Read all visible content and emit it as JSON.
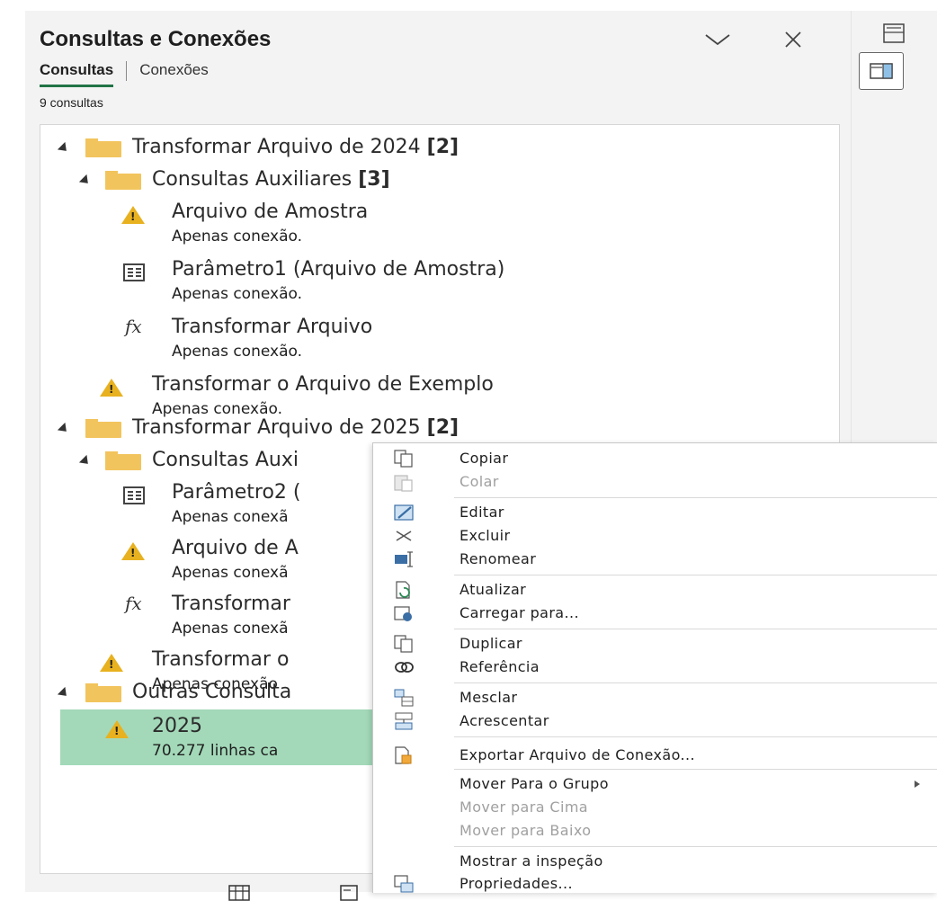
{
  "pane": {
    "title": "Consultas e Conexões",
    "tabs": [
      {
        "label": "Consultas",
        "active": true
      },
      {
        "label": "Conexões",
        "active": false
      }
    ],
    "query_count": "9 consultas"
  },
  "tree": {
    "group1": {
      "name": "Transformar Arquivo de 2024",
      "badge": "[2]"
    },
    "group1_sub": {
      "name": "Consultas Auxiliares",
      "badge": "[3]"
    },
    "q1": {
      "name": "Arquivo de Amostra",
      "status": "Apenas conexão."
    },
    "q2": {
      "name": "Parâmetro1 (Arquivo de Amostra)",
      "status": "Apenas conexão."
    },
    "q3": {
      "name": "Transformar Arquivo",
      "status": "Apenas conexão."
    },
    "q4": {
      "name": "Transformar o Arquivo de Exemplo",
      "status": "Apenas conexão."
    },
    "group2": {
      "name": "Transformar Arquivo de 2025",
      "badge": "[2]"
    },
    "group2_sub": {
      "name": "Consultas Auxi"
    },
    "q5": {
      "name": "Parâmetro2 (",
      "status": "Apenas conexã"
    },
    "q6": {
      "name": "Arquivo de A",
      "status": "Apenas conexã"
    },
    "q7": {
      "name": "Transformar ",
      "status": "Apenas conexã"
    },
    "q8": {
      "name": "Transformar o",
      "status": "Apenas conexão"
    },
    "group3": {
      "name": "Outras Consulta"
    },
    "q9": {
      "name": "2025",
      "status": "70.277 linhas ca"
    }
  },
  "context_menu": {
    "items": [
      {
        "label": "Copiar",
        "enabled": true,
        "icon": "copy-icon"
      },
      {
        "label": "Colar",
        "enabled": false,
        "icon": "paste-icon"
      },
      {
        "label": "Editar",
        "enabled": true,
        "icon": "edit-icon"
      },
      {
        "label": "Excluir",
        "enabled": true,
        "icon": "delete-icon"
      },
      {
        "label": "Renomear",
        "enabled": true,
        "icon": "rename-icon"
      },
      {
        "label": "Atualizar",
        "enabled": true,
        "icon": "refresh-icon"
      },
      {
        "label": "Carregar para...",
        "enabled": true,
        "icon": "load-to-icon"
      },
      {
        "label": "Duplicar",
        "enabled": true,
        "icon": "duplicate-icon"
      },
      {
        "label": "Referência",
        "enabled": true,
        "icon": "reference-icon"
      },
      {
        "label": "Mesclar",
        "enabled": true,
        "icon": "merge-icon"
      },
      {
        "label": "Acrescentar",
        "enabled": true,
        "icon": "append-icon"
      },
      {
        "label": "Exportar Arquivo de Conexão...",
        "enabled": true,
        "icon": "export-icon"
      },
      {
        "label": "Mover Para o Grupo",
        "enabled": true,
        "icon": ""
      },
      {
        "label": "Mover para Cima",
        "enabled": false,
        "icon": ""
      },
      {
        "label": "Mover para Baixo",
        "enabled": false,
        "icon": ""
      },
      {
        "label": "Mostrar a inspeção",
        "enabled": true,
        "icon": ""
      },
      {
        "label": "Propriedades...",
        "enabled": true,
        "icon": "properties-icon"
      }
    ]
  },
  "colors": {
    "accent": "#217346",
    "selected_row": "#a3d9b9",
    "folder": "#f2c45d",
    "warning": "#e8b11f"
  }
}
